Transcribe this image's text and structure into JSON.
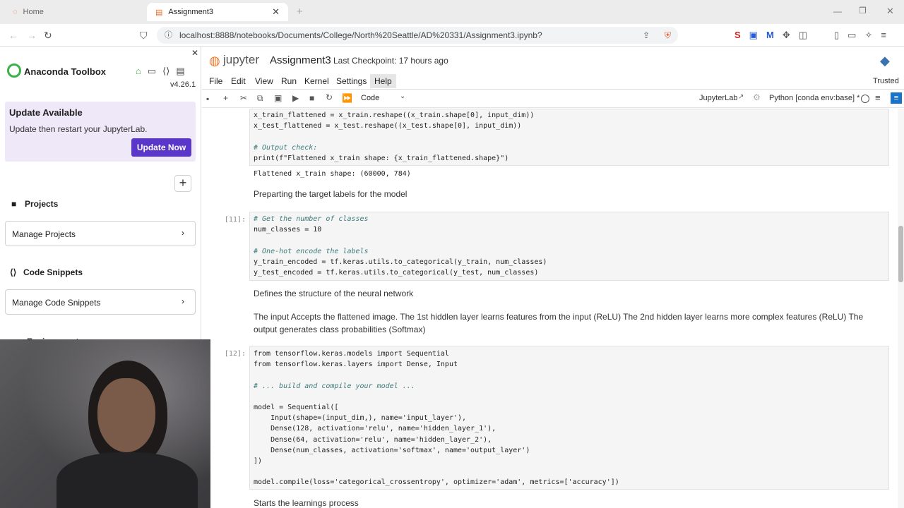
{
  "browser": {
    "tabs": [
      {
        "label": "Home"
      },
      {
        "label": "Assignment3"
      }
    ],
    "url": "localhost:8888/notebooks/Documents/College/North%20Seattle/AD%20331/Assignment3.ipynb?"
  },
  "sidebar": {
    "title": "Anaconda Toolbox",
    "version": "v4.26.1",
    "update": {
      "heading": "Update Available",
      "text": "Update then restart your JupyterLab.",
      "button": "Update Now"
    },
    "projects_heading": "Projects",
    "manage_projects": "Manage Projects",
    "snippets_heading": "Code Snippets",
    "manage_snippets": "Manage Code Snippets",
    "environments_heading": "Environments"
  },
  "header": {
    "logo_text": "jupyter",
    "notebook_name": "Assignment3",
    "checkpoint": "Last Checkpoint: 17 hours ago"
  },
  "menu": [
    "File",
    "Edit",
    "View",
    "Run",
    "Kernel",
    "Settings",
    "Help"
  ],
  "trusted": "Trusted",
  "toolbar": {
    "cell_type": "Code",
    "jupyterlab_link": "JupyterLab",
    "kernel": "Python [conda env:base] *"
  },
  "notebook": {
    "cell_top": {
      "lines": [
        "x_train_flattened = x_train.reshape((x_train.shape[0], input_dim))",
        "x_test_flattened = x_test.reshape((x_test.shape[0], input_dim))",
        "",
        "# Output check:",
        "print(f\"Flattened x_train shape: {x_train_flattened.shape}\")"
      ],
      "output": "Flattened x_train shape: (60000, 784)"
    },
    "md1": "Preparting the target labels for the model",
    "cell11": {
      "prompt": "[11]:",
      "lines": [
        "# Get the number of classes",
        "num_classes = 10",
        "",
        "# One-hot encode the labels",
        "y_train_encoded = tf.keras.utils.to_categorical(y_train, num_classes)",
        "y_test_encoded = tf.keras.utils.to_categorical(y_test, num_classes)"
      ]
    },
    "md2": "Defines the structure of the neural network",
    "md3": "The input Accepts the flattened image. The 1st hiddlen layer learns features from the input (ReLU) The 2nd hidden layer learns more complex features (ReLU) The output generates class probabilities (Softmax)",
    "cell12": {
      "prompt": "[12]:",
      "lines": [
        "from tensorflow.keras.models import Sequential",
        "from tensorflow.keras.layers import Dense, Input",
        "",
        "# ... build and compile your model ...",
        "",
        "model = Sequential([",
        "    Input(shape=(input_dim,), name='input_layer'),",
        "    Dense(128, activation='relu', name='hidden_layer_1'),",
        "    Dense(64, activation='relu', name='hidden_layer_2'),",
        "    Dense(num_classes, activation='softmax', name='output_layer')",
        "])",
        "",
        "model.compile(loss='categorical_crossentropy', optimizer='adam', metrics=['accuracy'])"
      ]
    },
    "md4": "Starts the learnings process"
  }
}
